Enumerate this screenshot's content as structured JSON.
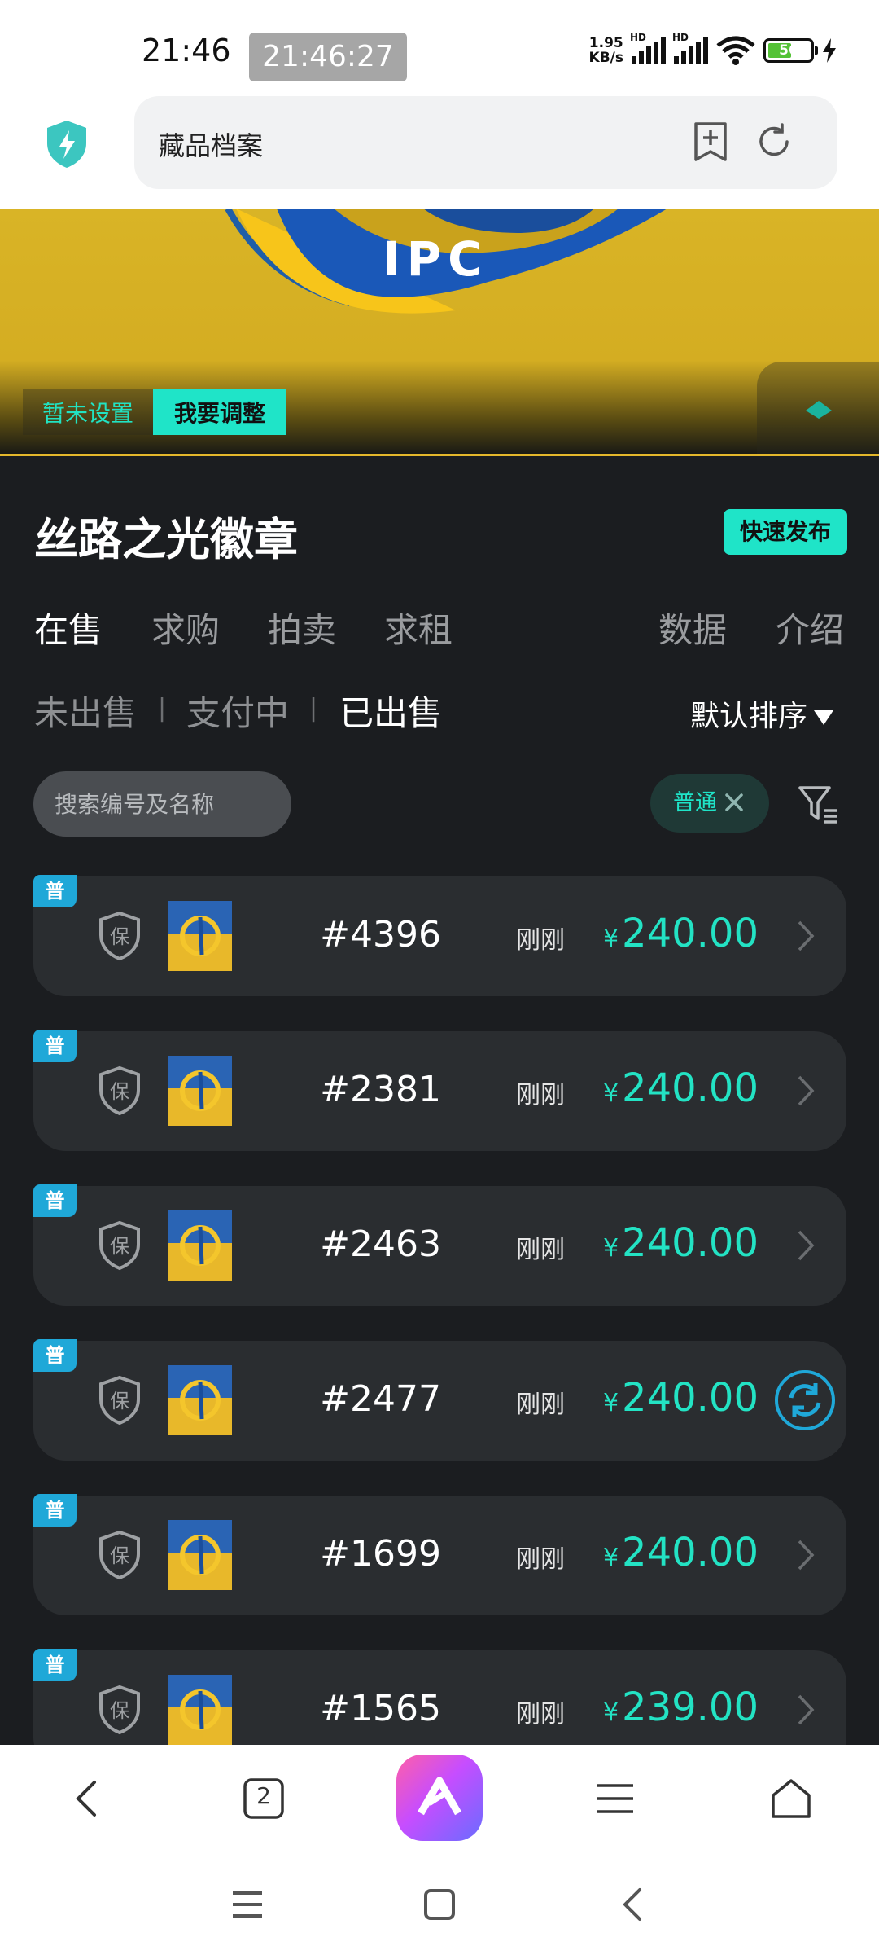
{
  "status": {
    "time": "21:46",
    "clock": "21:46:27",
    "speed_value": "1.95",
    "speed_unit": "KB/s",
    "signal1_label": "HD",
    "signal2_label": "HD",
    "battery": "56"
  },
  "browser": {
    "page_title": "藏品档案"
  },
  "banner": {
    "logo_text": "IPC",
    "tag_unset": "暂未设置",
    "tag_adjust": "我要调整"
  },
  "header": {
    "title": "丝路之光徽章",
    "quick_publish": "快速发布"
  },
  "tabs": [
    {
      "label": "在售",
      "active": true
    },
    {
      "label": "求购",
      "active": false
    },
    {
      "label": "拍卖",
      "active": false
    },
    {
      "label": "求租",
      "active": false
    },
    {
      "label": "数据",
      "active": false
    },
    {
      "label": "介绍",
      "active": false
    }
  ],
  "subtabs": [
    {
      "label": "未出售",
      "active": false
    },
    {
      "label": "支付中",
      "active": false
    },
    {
      "label": "已出售",
      "active": true
    }
  ],
  "subtab_separator": "|",
  "sort": {
    "label": "默认排序"
  },
  "search": {
    "placeholder": "搜索编号及名称"
  },
  "filter_chip": {
    "label": "普通"
  },
  "listings": [
    {
      "badge": "普",
      "guarantee": "保",
      "number": "#4396",
      "time": "刚刚",
      "currency": "¥",
      "price": "240.00",
      "action": "chevron"
    },
    {
      "badge": "普",
      "guarantee": "保",
      "number": "#2381",
      "time": "刚刚",
      "currency": "¥",
      "price": "240.00",
      "action": "chevron"
    },
    {
      "badge": "普",
      "guarantee": "保",
      "number": "#2463",
      "time": "刚刚",
      "currency": "¥",
      "price": "240.00",
      "action": "chevron"
    },
    {
      "badge": "普",
      "guarantee": "保",
      "number": "#2477",
      "time": "刚刚",
      "currency": "¥",
      "price": "240.00",
      "action": "refresh"
    },
    {
      "badge": "普",
      "guarantee": "保",
      "number": "#1699",
      "time": "刚刚",
      "currency": "¥",
      "price": "240.00",
      "action": "chevron"
    },
    {
      "badge": "普",
      "guarantee": "保",
      "number": "#1565",
      "time": "刚刚",
      "currency": "¥",
      "price": "239.00",
      "action": "chevron"
    }
  ],
  "bottom_nav": {
    "tab_count": "2"
  },
  "colors": {
    "accent": "#1fe4c8",
    "price": "#23e3c4",
    "badge": "#1fa8d8",
    "background": "#1b1d20",
    "card": "#2a2d30"
  }
}
